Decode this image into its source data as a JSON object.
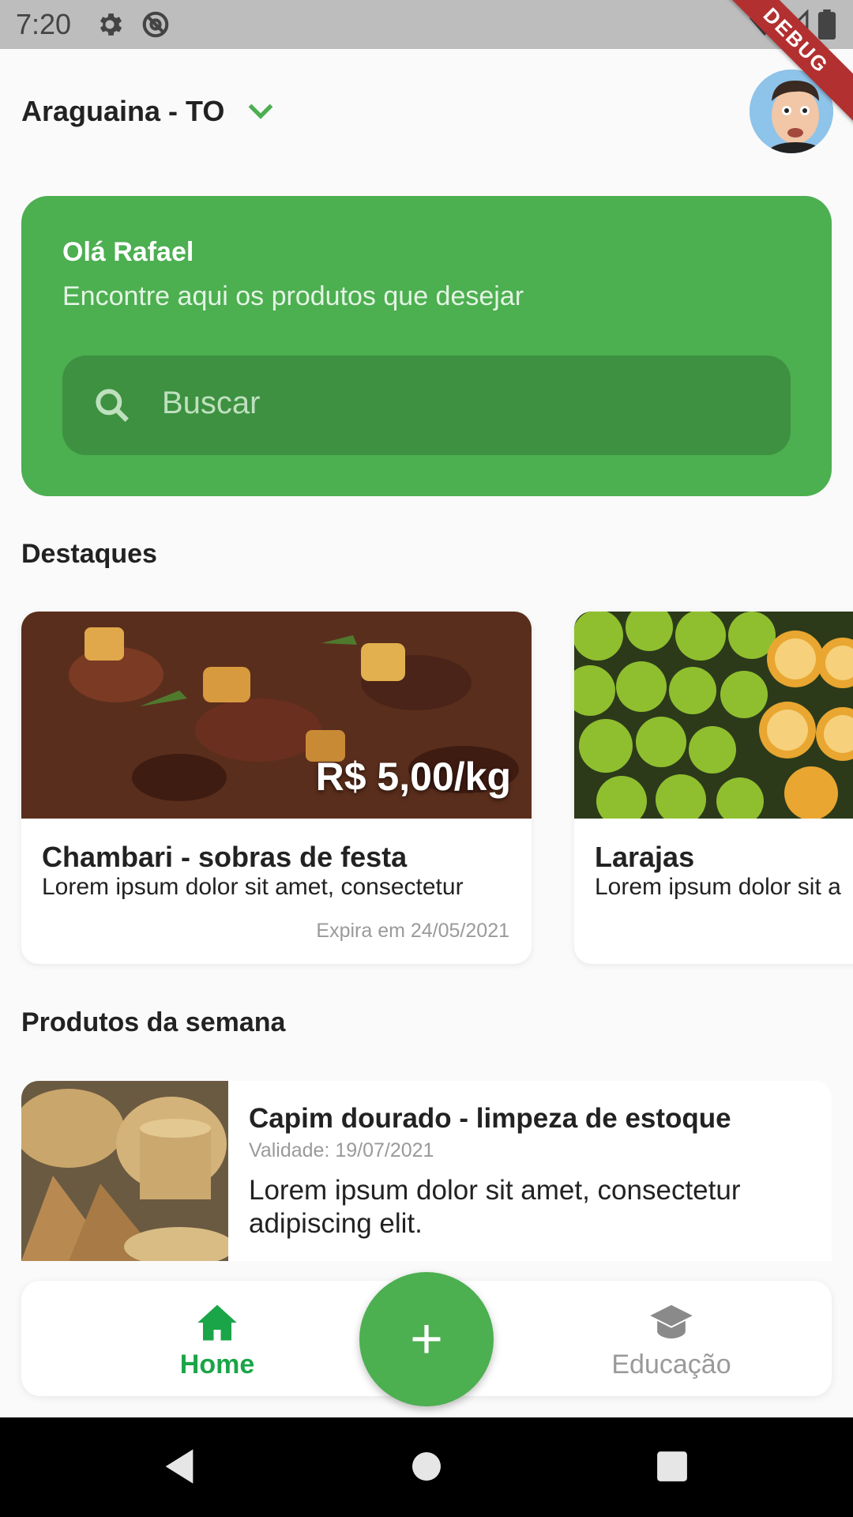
{
  "status_bar": {
    "time": "7:20",
    "debug_label": "DEBUG"
  },
  "header": {
    "location": "Araguaina - TO"
  },
  "hero": {
    "greeting": "Olá Rafael",
    "subtitle": "Encontre aqui os produtos que desejar",
    "search_placeholder": "Buscar"
  },
  "highlights": {
    "title": "Destaques",
    "items": [
      {
        "title": "Chambari - sobras de festa",
        "description": "Lorem ipsum dolor sit amet, consectetur",
        "price": "R$ 5,00/kg",
        "expires": "Expira em 24/05/2021"
      },
      {
        "title": "Larajas",
        "description": "Lorem ipsum dolor sit a"
      }
    ]
  },
  "week_products": {
    "title": "Produtos da semana",
    "items": [
      {
        "title": "Capim dourado - limpeza de estoque",
        "validity": "Validade: 19/07/2021",
        "description": "Lorem ipsum dolor sit amet, consectetur adipiscing elit."
      }
    ]
  },
  "bottom_nav": {
    "home_label": "Home",
    "fab_label": "+",
    "education_label": "Educação"
  },
  "colors": {
    "primary": "#4caf50",
    "active_nav": "#1aa548",
    "search_bg": "#3d9140"
  },
  "icons": [
    "settings-icon",
    "at-icon",
    "wifi-icon",
    "signal-icon",
    "battery-icon",
    "chevron-down-icon",
    "search-icon",
    "home-icon",
    "plus-icon",
    "graduation-cap-icon",
    "back-icon",
    "home-circle-icon",
    "recents-icon"
  ]
}
